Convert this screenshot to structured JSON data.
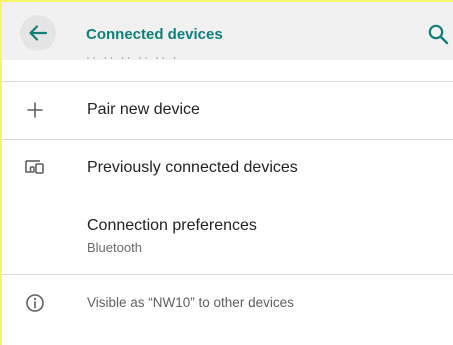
{
  "appbar": {
    "title": "Connected devices",
    "back_icon": "arrow-back-icon",
    "search_icon": "search-icon",
    "accent_color": "#0f7f7a",
    "partial_text": "·· ·· ·· ·· ·· ·"
  },
  "rows": [
    {
      "icon": "plus-icon",
      "title": "Pair new device"
    },
    {
      "icon": "devices-icon",
      "title": "Previously connected devices"
    },
    {
      "title": "Connection preferences",
      "subtitle": "Bluetooth"
    }
  ],
  "footer": {
    "icon": "info-icon",
    "text": "Visible as “NW10” to other devices"
  }
}
